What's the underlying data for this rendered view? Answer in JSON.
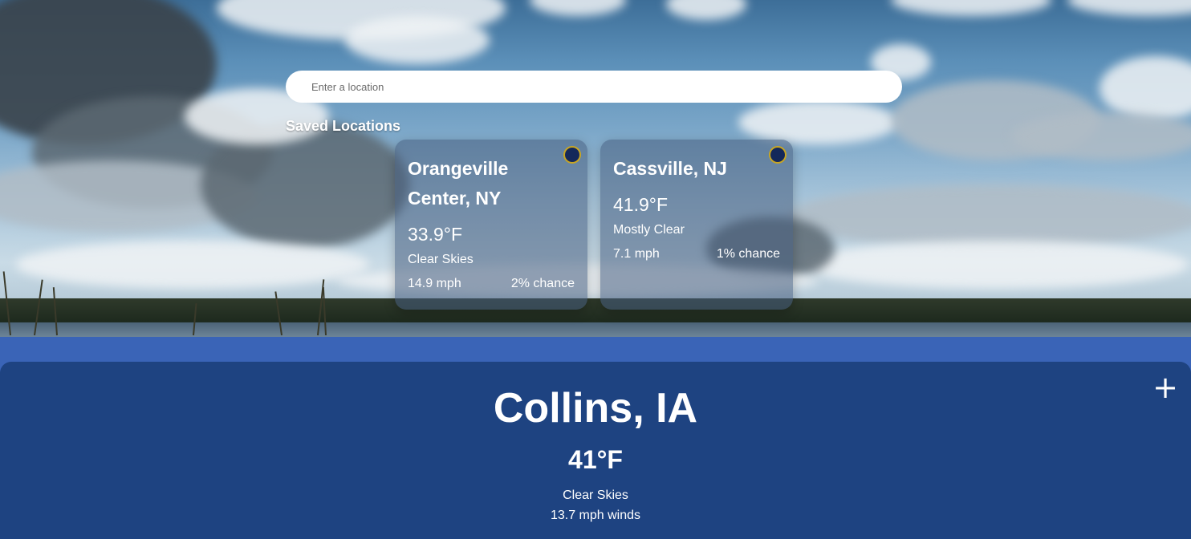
{
  "search": {
    "placeholder": "Enter a location"
  },
  "saved": {
    "title": "Saved Locations",
    "cards": [
      {
        "name": "Orangeville Center, NY",
        "temp": "33.9°F",
        "condition": "Clear Skies",
        "wind": "14.9 mph",
        "precip": "2% chance",
        "icon": "moon-icon"
      },
      {
        "name": "Cassville, NJ",
        "temp": "41.9°F",
        "condition": "Mostly Clear",
        "wind": "7.1 mph",
        "precip": "1% chance",
        "icon": "moon-icon"
      }
    ]
  },
  "current": {
    "city": "Collins, IA",
    "temp": "41°F",
    "condition": "Clear Skies",
    "wind": "13.7 mph winds",
    "add_label": "+"
  },
  "colors": {
    "panel": "#1e4381",
    "page_band": "#3a64b7",
    "card_glass": "rgba(70,92,125,0.55)",
    "moon_icon_fill": "#14285a",
    "moon_icon_ring": "#c9a622"
  }
}
